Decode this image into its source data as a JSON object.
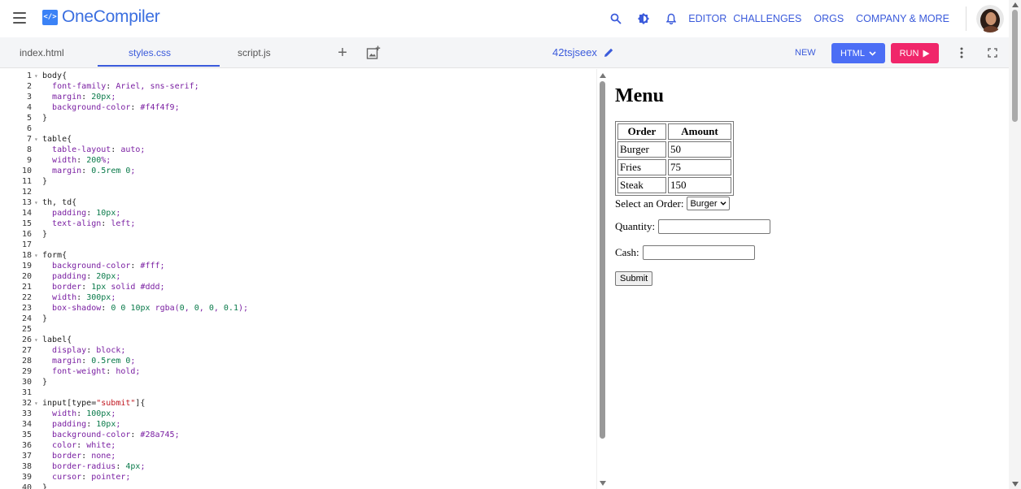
{
  "app": {
    "name": "OneCompiler",
    "logo_text": "</>"
  },
  "nav": {
    "links": [
      "EDITOR",
      "CHALLENGES",
      "ORGS",
      "COMPANY & MORE"
    ]
  },
  "tabs": [
    {
      "label": "index.html",
      "active": false
    },
    {
      "label": "styles.css",
      "active": true
    },
    {
      "label": "script.js",
      "active": false
    }
  ],
  "toolbar": {
    "add_label": "+",
    "filename": "42tsjseex",
    "new_label": "NEW",
    "language_label": "HTML",
    "run_label": "RUN"
  },
  "colors": {
    "accent": "#3b5bdb",
    "run": "#f0266a",
    "language": "#4c6ef5"
  },
  "code_lines": [
    {
      "n": "1",
      "t": "body{",
      "fold": true
    },
    {
      "n": "2",
      "t": "  font-family: Ariel, sns-serif;"
    },
    {
      "n": "3",
      "t": "  margin: 20px;"
    },
    {
      "n": "4",
      "t": "  background-color: #f4f4f9;"
    },
    {
      "n": "5",
      "t": "}"
    },
    {
      "n": "6",
      "t": ""
    },
    {
      "n": "7",
      "t": "table{",
      "fold": true
    },
    {
      "n": "8",
      "t": "  table-layout: auto;"
    },
    {
      "n": "9",
      "t": "  width: 200%;"
    },
    {
      "n": "10",
      "t": "  margin: 0.5rem 0;"
    },
    {
      "n": "11",
      "t": "}"
    },
    {
      "n": "12",
      "t": ""
    },
    {
      "n": "13",
      "t": "th, td{",
      "fold": true
    },
    {
      "n": "14",
      "t": "  padding: 10px;"
    },
    {
      "n": "15",
      "t": "  text-align: left;"
    },
    {
      "n": "16",
      "t": "}"
    },
    {
      "n": "17",
      "t": ""
    },
    {
      "n": "18",
      "t": "form{",
      "fold": true
    },
    {
      "n": "19",
      "t": "  background-color: #fff;"
    },
    {
      "n": "20",
      "t": "  padding: 20px;"
    },
    {
      "n": "21",
      "t": "  border: 1px solid #ddd;"
    },
    {
      "n": "22",
      "t": "  width: 300px;"
    },
    {
      "n": "23",
      "t": "  box-shadow: 0 0 10px rgba(0, 0, 0, 0.1);"
    },
    {
      "n": "24",
      "t": "}"
    },
    {
      "n": "25",
      "t": ""
    },
    {
      "n": "26",
      "t": "label{",
      "fold": true
    },
    {
      "n": "27",
      "t": "  display: block;"
    },
    {
      "n": "28",
      "t": "  margin: 0.5rem 0;"
    },
    {
      "n": "29",
      "t": "  font-weight: hold;"
    },
    {
      "n": "30",
      "t": "}"
    },
    {
      "n": "31",
      "t": ""
    },
    {
      "n": "32",
      "t": "input[type=\"submit\"]{",
      "fold": true
    },
    {
      "n": "33",
      "t": "  width: 100px;"
    },
    {
      "n": "34",
      "t": "  padding: 10px;"
    },
    {
      "n": "35",
      "t": "  background-color: #28a745;"
    },
    {
      "n": "36",
      "t": "  color: white;"
    },
    {
      "n": "37",
      "t": "  border: none;"
    },
    {
      "n": "38",
      "t": "  border-radius: 4px;"
    },
    {
      "n": "39",
      "t": "  cursor: pointer;"
    },
    {
      "n": "40",
      "t": "}"
    }
  ],
  "preview": {
    "title": "Menu",
    "table": {
      "headers": [
        "Order",
        "Amount"
      ],
      "rows": [
        [
          "Burger",
          "50"
        ],
        [
          "Fries",
          "75"
        ],
        [
          "Steak",
          "150"
        ]
      ]
    },
    "select_label": "Select an Order:",
    "select_value": "Burger",
    "quantity_label": "Quantity:",
    "quantity_value": "",
    "cash_label": "Cash:",
    "cash_value": "",
    "submit_label": "Submit"
  }
}
